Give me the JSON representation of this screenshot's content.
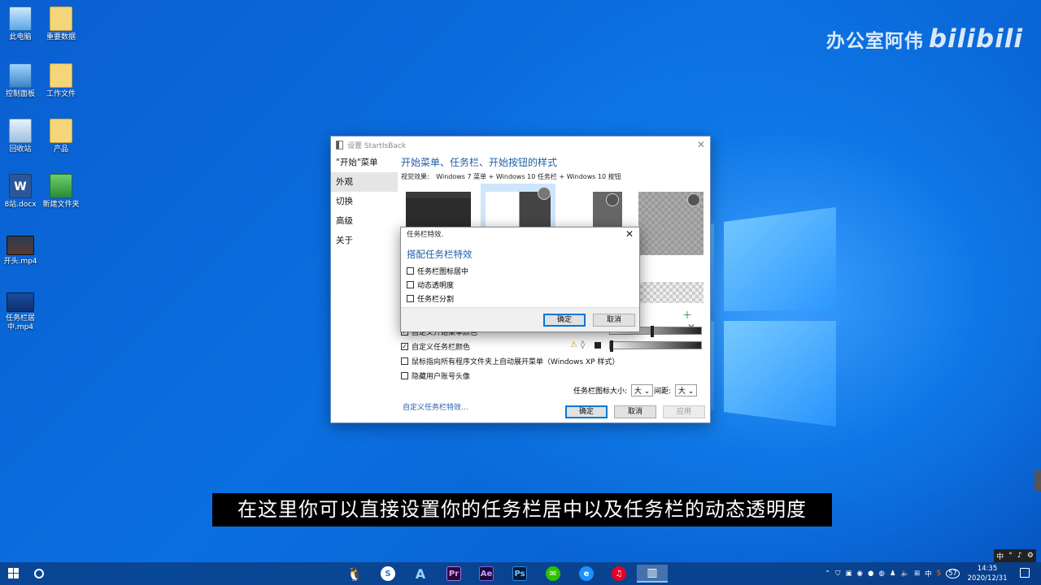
{
  "desktop": {
    "icons": [
      {
        "label": "此电脑",
        "icon": "computer-icon"
      },
      {
        "label": "重要数据",
        "icon": "folder-icon"
      },
      {
        "label": "控制面板",
        "icon": "control-panel-icon"
      },
      {
        "label": "工作文件",
        "icon": "folder-icon"
      },
      {
        "label": "回收站",
        "icon": "recycle-bin-icon"
      },
      {
        "label": "产品",
        "icon": "folder-icon"
      },
      {
        "label": "8站.docx",
        "icon": "word-doc-icon"
      },
      {
        "label": "新建文件夹",
        "icon": "folder-icon"
      },
      {
        "label": "开头.mp4",
        "icon": "video-file-icon"
      },
      {
        "label": "任务栏居中.mp4",
        "icon": "video-file-icon"
      }
    ]
  },
  "watermark": {
    "text": "办公室阿伟",
    "brand": "bilibili"
  },
  "settings_window": {
    "title": "设置 StartIsBack",
    "sidebar": [
      "\"开始\"菜单",
      "外观",
      "切换",
      "高级",
      "关于"
    ],
    "active_index": 1,
    "heading": "开始菜单、任务栏、开始按钮的样式",
    "visual_label": "视觉效果:",
    "visual_value": "Windows 7 菜单 + Windows 10 任务栏 + Windows 10 按钮",
    "opt_custom_start_color": "自定义开始菜单颜色",
    "opt_custom_taskbar_color": "自定义任务栏颜色",
    "opt_hover_expand": "鼠标指向所有程序文件夹上自动展开菜单（Windows XP 样式）",
    "opt_hide_avatar": "隐藏用户账号头像",
    "link_taskbar_effects": "自定义任务栏特效...",
    "icon_size_label": "任务栏图标大小:",
    "icon_size_value": "大",
    "spacing_label": "间距:",
    "spacing_value": "大",
    "btn_ok": "确定",
    "btn_cancel": "取消",
    "btn_apply": "应用"
  },
  "dialog": {
    "title": "任务栏特效.",
    "heading": "搭配任务栏特效",
    "options": [
      "任务栏图标居中",
      "动态透明度",
      "任务栏分割"
    ],
    "btn_ok": "确定",
    "btn_cancel": "取消"
  },
  "subtitle": "在这里你可以直接设置你的任务栏居中以及任务栏的动态透明度",
  "taskbar": {
    "apps": [
      {
        "name": "qq-icon",
        "label": "🐧"
      },
      {
        "name": "sogou-icon",
        "label": "S"
      },
      {
        "name": "autocad-icon",
        "label": "A"
      },
      {
        "name": "premiere-icon",
        "label": "Pr"
      },
      {
        "name": "after-effects-icon",
        "label": "Ae"
      },
      {
        "name": "photoshop-icon",
        "label": "Ps"
      },
      {
        "name": "wechat-icon",
        "label": "✉"
      },
      {
        "name": "edge-icon",
        "label": "e"
      },
      {
        "name": "netease-music-icon",
        "label": "♫"
      },
      {
        "name": "startisback-icon",
        "label": "▥"
      }
    ],
    "tray_ime": "中",
    "tray_badge": "57",
    "time": "14:35",
    "date": "2020/12/31",
    "ime_bar": [
      "中",
      "°",
      "♪",
      "⚙"
    ]
  }
}
